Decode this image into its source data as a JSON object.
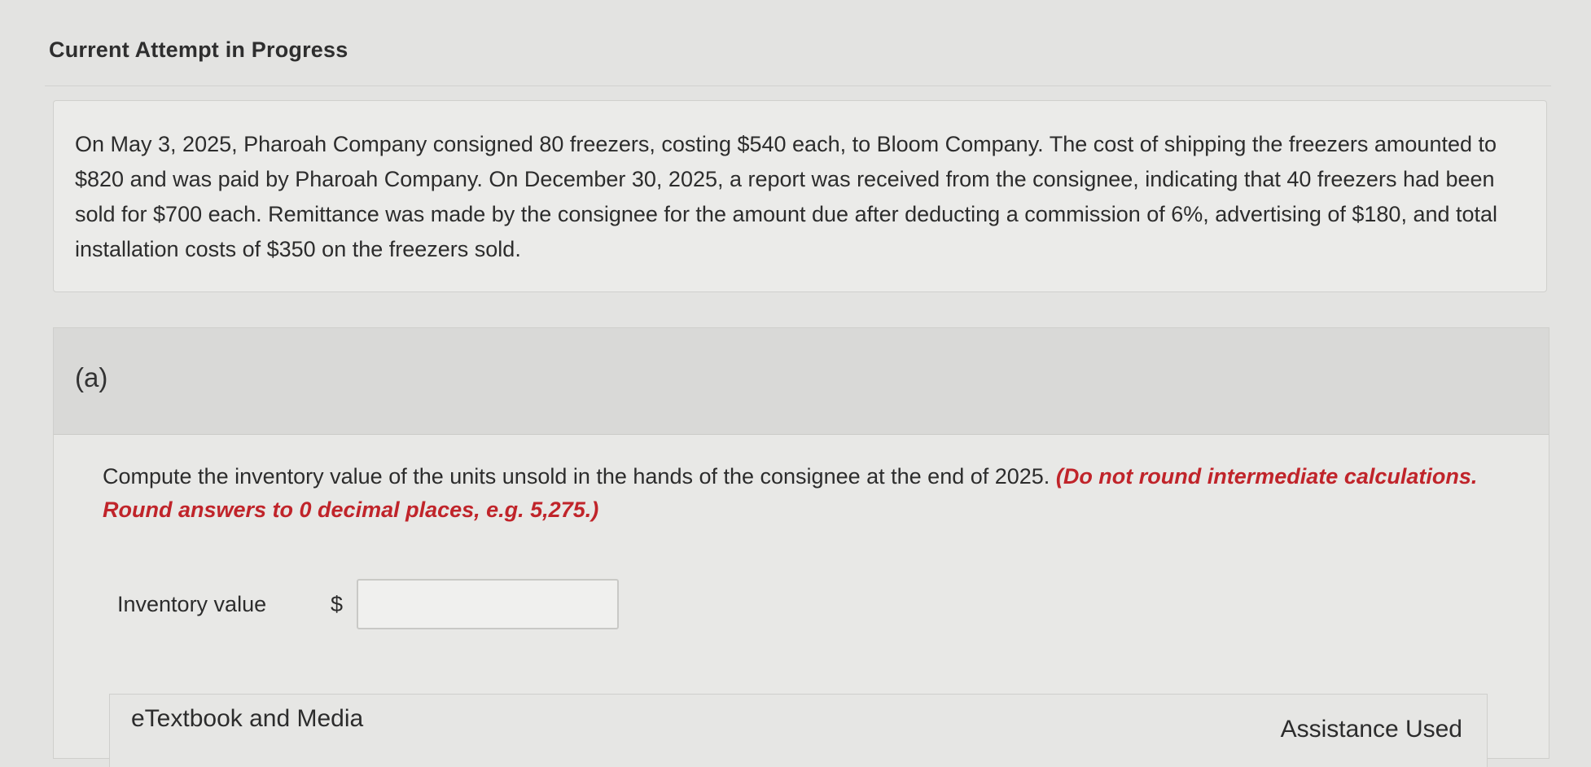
{
  "header": {
    "title": "Current Attempt in Progress"
  },
  "problem": {
    "text": "On May 3, 2025, Pharoah Company consigned 80 freezers, costing $540 each, to Bloom Company. The cost of shipping the freezers amounted to $820 and was paid by Pharoah Company. On December 30, 2025, a report was received from the consignee, indicating that 40 freezers had been sold for $700 each. Remittance was made by the consignee for the amount due after deducting a commission of 6%, advertising of $180, and total installation costs of $350 on the freezers sold."
  },
  "part_a": {
    "label": "(a)",
    "instruction": "Compute the inventory value of the units unsold in the hands of the consignee at the end of 2025.",
    "note": "(Do not round intermediate calculations. Round answers to 0 decimal places, e.g. 5,275.)",
    "answer": {
      "label": "Inventory value",
      "currency_symbol": "$",
      "value": ""
    }
  },
  "resources": {
    "etextbook_label": "eTextbook and Media",
    "assistance_label": "Assistance Used"
  },
  "colors": {
    "note_red": "#c0242a",
    "background": "#e3e3e1"
  }
}
